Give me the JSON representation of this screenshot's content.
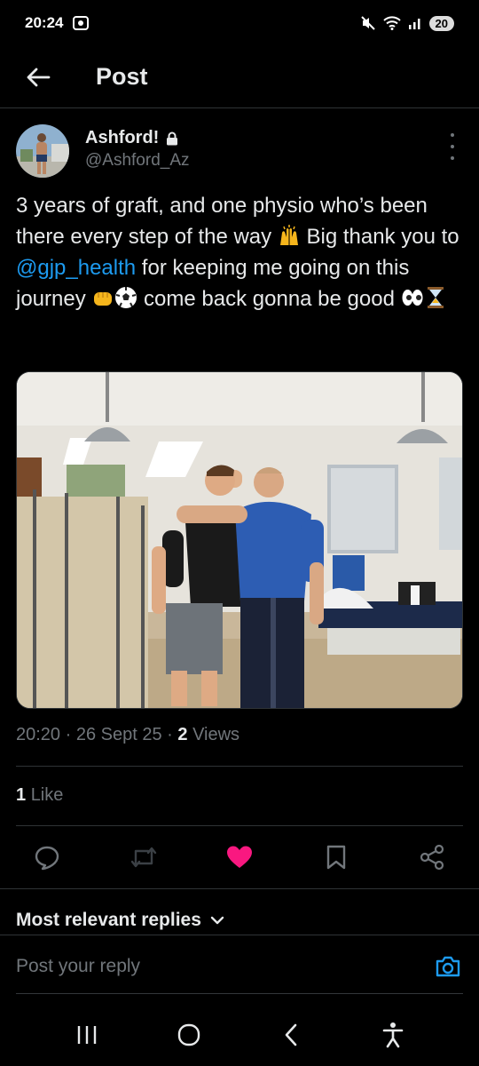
{
  "status_bar": {
    "time": "20:24",
    "battery": "20"
  },
  "header": {
    "title": "Post"
  },
  "author": {
    "name": "Ashford!",
    "handle": "@Ashford_Az"
  },
  "post": {
    "text_part1": "3 years of graft, and one physio who’s been there every step of the way",
    "text_part2": " Big thank you to ",
    "mention": "@gjp_health",
    "text_part3": " for keeping me going on this journey ",
    "text_part4": " come back gonna be good "
  },
  "meta": {
    "time": "20:20",
    "date": "26 Sept 25",
    "views_count": "2",
    "views_label": "Views"
  },
  "likes": {
    "count": "1",
    "label": "Like"
  },
  "replies": {
    "sort_label": "Most relevant replies",
    "placeholder": "Post your reply"
  },
  "colors": {
    "accent": "#1d9bf0",
    "like": "#f91880",
    "background": "#000000",
    "muted": "#71767b"
  },
  "icons": [
    "back-arrow-icon",
    "lock-icon",
    "more-icon",
    "raised-hands-emoji",
    "fist-emoji",
    "soccer-ball-emoji",
    "eyes-emoji",
    "hourglass-emoji",
    "reply-icon",
    "repost-icon",
    "heart-icon",
    "bookmark-icon",
    "share-icon",
    "chevron-down-icon",
    "camera-icon",
    "recents-icon",
    "home-icon",
    "back-icon",
    "accessibility-icon"
  ]
}
